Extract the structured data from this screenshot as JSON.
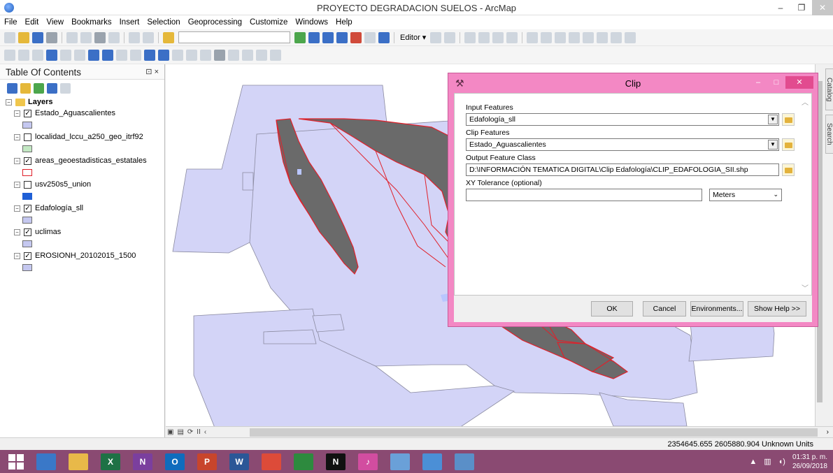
{
  "window": {
    "title": "PROYECTO DEGRADACION SUELOS - ArcMap",
    "minimize": "–",
    "maximize": "❐",
    "close": "✕"
  },
  "menu": [
    "File",
    "Edit",
    "View",
    "Bookmarks",
    "Insert",
    "Selection",
    "Geoprocessing",
    "Customize",
    "Windows",
    "Help"
  ],
  "toolbar": {
    "editor_label": "Editor ▾"
  },
  "toc": {
    "title": "Table Of Contents",
    "pin": "⊡ ×",
    "group": {
      "name": "Layers"
    },
    "layers": [
      {
        "name": "Estado_Aguascalientes",
        "checked": "✓",
        "swatch_fill": "#c5c8f0",
        "swatch_border": "#6e6e6e"
      },
      {
        "name": "localidad_lccu_a250_geo_itrf92",
        "checked": "",
        "swatch_fill": "#c3e8c3",
        "swatch_border": "#6e6e6e"
      },
      {
        "name": "areas_geoestadisticas_estatales",
        "checked": "✓",
        "swatch_fill": "#ffffff",
        "swatch_border": "#e0202a"
      },
      {
        "name": "usv250s5_union",
        "checked": "",
        "swatch_fill": "#1f5fd6",
        "swatch_border": "#1f5fd6"
      },
      {
        "name": "Edafología_sll",
        "checked": "✓",
        "swatch_fill": "#c5c8f0",
        "swatch_border": "#6e6e6e"
      },
      {
        "name": "uclimas",
        "checked": "✓",
        "swatch_fill": "#c5c8f0",
        "swatch_border": "#6e6e6e"
      },
      {
        "name": "EROSIONH_20102015_1500",
        "checked": "✓",
        "swatch_fill": "#c5c8f0",
        "swatch_border": "#6e6e6e"
      }
    ]
  },
  "map": {
    "colors": {
      "background": "#ffffff",
      "grid_fill": "#d3d4f7",
      "grid_stroke": "#8a8aa0",
      "land": "#6a6a6a",
      "state_lines": "#e0202a",
      "water": "#b9c6ff"
    }
  },
  "side_tabs": {
    "catalog": "Catalog",
    "search": "Search"
  },
  "map_controls": {
    "layout_view": "▣",
    "data_view": "▤",
    "refresh": "⟳",
    "pause": "II",
    "scroll_left": "‹",
    "scroll_right": "›"
  },
  "status": {
    "coordinates": "2354645.655  2605880.904 Unknown Units"
  },
  "clip_dialog": {
    "icon": "⚒",
    "title": "Clip",
    "input_features_label": "Input Features",
    "input_features_value": "Edafología_sll",
    "clip_features_label": "Clip Features",
    "clip_features_value": "Estado_Aguascalientes",
    "output_label": "Output Feature Class",
    "output_value": "D:\\INFORMACIÓN TEMATICA DIGITAL\\Clip Edafología\\CLIP_EDAFOLOGIA_SII.shp",
    "xy_label": "XY Tolerance (optional)",
    "xy_value": "",
    "units_value": "Meters",
    "ok": "OK",
    "cancel": "Cancel",
    "environments": "Environments...",
    "show_help": "Show Help >>"
  },
  "taskbar": {
    "apps": [
      {
        "name": "file-explorer",
        "color": "#3a78c8",
        "label": ""
      },
      {
        "name": "folder",
        "color": "#e8b949",
        "label": ""
      },
      {
        "name": "excel",
        "color": "#1e7145",
        "label": "X"
      },
      {
        "name": "onenote",
        "color": "#7b3f9e",
        "label": "N"
      },
      {
        "name": "outlook",
        "color": "#0f6cbd",
        "label": "O"
      },
      {
        "name": "powerpoint",
        "color": "#c8452c",
        "label": "P"
      },
      {
        "name": "word",
        "color": "#2b5797",
        "label": "W"
      },
      {
        "name": "chrome",
        "color": "#dd4b39",
        "label": ""
      },
      {
        "name": "store",
        "color": "#2d8a3e",
        "label": ""
      },
      {
        "name": "netflix",
        "color": "#111111",
        "label": "N"
      },
      {
        "name": "itunes",
        "color": "#d24da0",
        "label": "♪"
      },
      {
        "name": "media",
        "color": "#6aa0d8",
        "label": ""
      },
      {
        "name": "arcmap",
        "color": "#4b8fd6",
        "label": ""
      },
      {
        "name": "remote",
        "color": "#5a8fc8",
        "label": ""
      }
    ],
    "clock_time": "01:31 p. m.",
    "clock_date": "26/09/2018"
  }
}
